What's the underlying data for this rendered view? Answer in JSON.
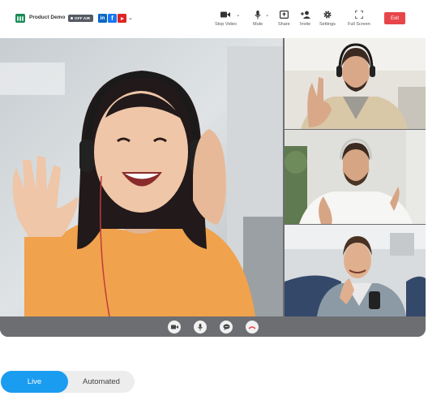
{
  "brand": {
    "name": "Product Demo",
    "status_badge": "OFF AIR",
    "logo_icon": "bars-logo-icon"
  },
  "social": [
    {
      "name": "linkedin",
      "glyph": "in",
      "color": "#0a66c2"
    },
    {
      "name": "facebook",
      "glyph": "f",
      "color": "#1877f2"
    },
    {
      "name": "youtube",
      "glyph": "play",
      "color": "#e02424"
    }
  ],
  "toolbar": {
    "stop_video": "Stop Video",
    "mute": "Mute",
    "share": "Share",
    "invite": "Invite",
    "settings": "Settings",
    "full_screen": "Full Screen",
    "exit": "Exit"
  },
  "colors": {
    "exit": "#e8454a",
    "live": "#1a9cf0",
    "hangup": "#e8454a",
    "stage": "#6d6e72"
  },
  "call_controls": [
    "camera-icon",
    "microphone-icon",
    "chat-icon",
    "hang-up-icon"
  ],
  "mode_toggle": {
    "live": "Live",
    "automated": "Automated",
    "selected": "Live"
  }
}
